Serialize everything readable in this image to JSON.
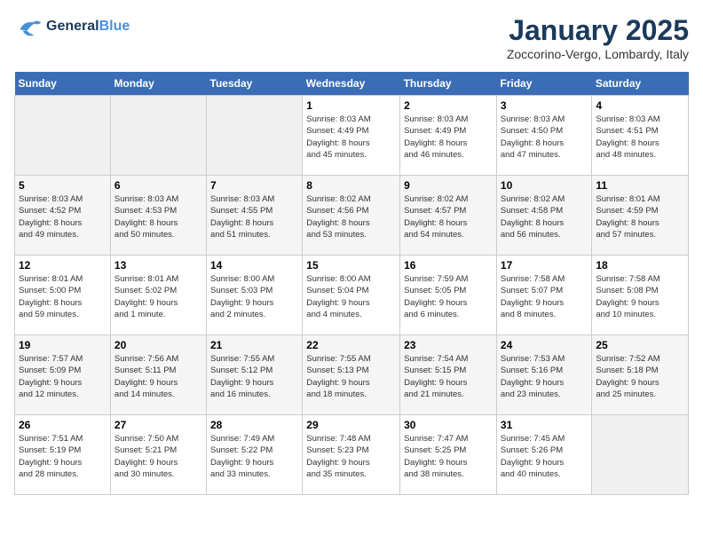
{
  "header": {
    "logo_line1": "General",
    "logo_line2": "Blue",
    "month": "January 2025",
    "location": "Zoccorino-Vergo, Lombardy, Italy"
  },
  "weekdays": [
    "Sunday",
    "Monday",
    "Tuesday",
    "Wednesday",
    "Thursday",
    "Friday",
    "Saturday"
  ],
  "weeks": [
    [
      {
        "day": "",
        "info": ""
      },
      {
        "day": "",
        "info": ""
      },
      {
        "day": "",
        "info": ""
      },
      {
        "day": "1",
        "info": "Sunrise: 8:03 AM\nSunset: 4:49 PM\nDaylight: 8 hours\nand 45 minutes."
      },
      {
        "day": "2",
        "info": "Sunrise: 8:03 AM\nSunset: 4:49 PM\nDaylight: 8 hours\nand 46 minutes."
      },
      {
        "day": "3",
        "info": "Sunrise: 8:03 AM\nSunset: 4:50 PM\nDaylight: 8 hours\nand 47 minutes."
      },
      {
        "day": "4",
        "info": "Sunrise: 8:03 AM\nSunset: 4:51 PM\nDaylight: 8 hours\nand 48 minutes."
      }
    ],
    [
      {
        "day": "5",
        "info": "Sunrise: 8:03 AM\nSunset: 4:52 PM\nDaylight: 8 hours\nand 49 minutes."
      },
      {
        "day": "6",
        "info": "Sunrise: 8:03 AM\nSunset: 4:53 PM\nDaylight: 8 hours\nand 50 minutes."
      },
      {
        "day": "7",
        "info": "Sunrise: 8:03 AM\nSunset: 4:55 PM\nDaylight: 8 hours\nand 51 minutes."
      },
      {
        "day": "8",
        "info": "Sunrise: 8:02 AM\nSunset: 4:56 PM\nDaylight: 8 hours\nand 53 minutes."
      },
      {
        "day": "9",
        "info": "Sunrise: 8:02 AM\nSunset: 4:57 PM\nDaylight: 8 hours\nand 54 minutes."
      },
      {
        "day": "10",
        "info": "Sunrise: 8:02 AM\nSunset: 4:58 PM\nDaylight: 8 hours\nand 56 minutes."
      },
      {
        "day": "11",
        "info": "Sunrise: 8:01 AM\nSunset: 4:59 PM\nDaylight: 8 hours\nand 57 minutes."
      }
    ],
    [
      {
        "day": "12",
        "info": "Sunrise: 8:01 AM\nSunset: 5:00 PM\nDaylight: 8 hours\nand 59 minutes."
      },
      {
        "day": "13",
        "info": "Sunrise: 8:01 AM\nSunset: 5:02 PM\nDaylight: 9 hours\nand 1 minute."
      },
      {
        "day": "14",
        "info": "Sunrise: 8:00 AM\nSunset: 5:03 PM\nDaylight: 9 hours\nand 2 minutes."
      },
      {
        "day": "15",
        "info": "Sunrise: 8:00 AM\nSunset: 5:04 PM\nDaylight: 9 hours\nand 4 minutes."
      },
      {
        "day": "16",
        "info": "Sunrise: 7:59 AM\nSunset: 5:05 PM\nDaylight: 9 hours\nand 6 minutes."
      },
      {
        "day": "17",
        "info": "Sunrise: 7:58 AM\nSunset: 5:07 PM\nDaylight: 9 hours\nand 8 minutes."
      },
      {
        "day": "18",
        "info": "Sunrise: 7:58 AM\nSunset: 5:08 PM\nDaylight: 9 hours\nand 10 minutes."
      }
    ],
    [
      {
        "day": "19",
        "info": "Sunrise: 7:57 AM\nSunset: 5:09 PM\nDaylight: 9 hours\nand 12 minutes."
      },
      {
        "day": "20",
        "info": "Sunrise: 7:56 AM\nSunset: 5:11 PM\nDaylight: 9 hours\nand 14 minutes."
      },
      {
        "day": "21",
        "info": "Sunrise: 7:55 AM\nSunset: 5:12 PM\nDaylight: 9 hours\nand 16 minutes."
      },
      {
        "day": "22",
        "info": "Sunrise: 7:55 AM\nSunset: 5:13 PM\nDaylight: 9 hours\nand 18 minutes."
      },
      {
        "day": "23",
        "info": "Sunrise: 7:54 AM\nSunset: 5:15 PM\nDaylight: 9 hours\nand 21 minutes."
      },
      {
        "day": "24",
        "info": "Sunrise: 7:53 AM\nSunset: 5:16 PM\nDaylight: 9 hours\nand 23 minutes."
      },
      {
        "day": "25",
        "info": "Sunrise: 7:52 AM\nSunset: 5:18 PM\nDaylight: 9 hours\nand 25 minutes."
      }
    ],
    [
      {
        "day": "26",
        "info": "Sunrise: 7:51 AM\nSunset: 5:19 PM\nDaylight: 9 hours\nand 28 minutes."
      },
      {
        "day": "27",
        "info": "Sunrise: 7:50 AM\nSunset: 5:21 PM\nDaylight: 9 hours\nand 30 minutes."
      },
      {
        "day": "28",
        "info": "Sunrise: 7:49 AM\nSunset: 5:22 PM\nDaylight: 9 hours\nand 33 minutes."
      },
      {
        "day": "29",
        "info": "Sunrise: 7:48 AM\nSunset: 5:23 PM\nDaylight: 9 hours\nand 35 minutes."
      },
      {
        "day": "30",
        "info": "Sunrise: 7:47 AM\nSunset: 5:25 PM\nDaylight: 9 hours\nand 38 minutes."
      },
      {
        "day": "31",
        "info": "Sunrise: 7:45 AM\nSunset: 5:26 PM\nDaylight: 9 hours\nand 40 minutes."
      },
      {
        "day": "",
        "info": ""
      }
    ]
  ]
}
